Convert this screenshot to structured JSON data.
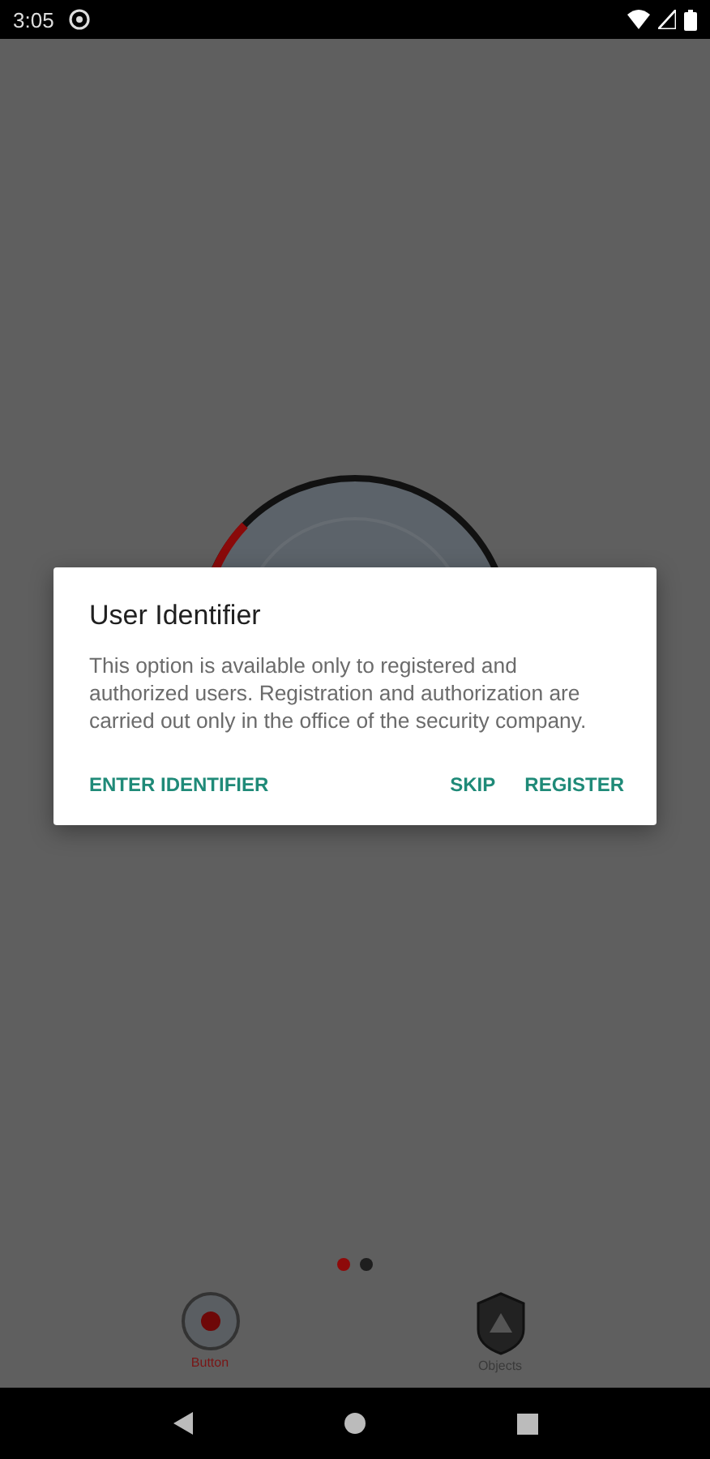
{
  "status_bar": {
    "time": "3:05"
  },
  "pages": [
    {
      "selected": true
    },
    {
      "selected": false
    }
  ],
  "bottom_nav": [
    {
      "label": "Button",
      "selected": true,
      "kind": "button"
    },
    {
      "label": "Objects",
      "selected": false,
      "kind": "shield"
    }
  ],
  "dialog": {
    "title": "User Identifier",
    "message": "This option is available only to registered and authorized users. Registration and authorization are carried out only in the office of the security company.",
    "actions": [
      "ENTER IDENTIFIER",
      "SKIP",
      "REGISTER"
    ]
  }
}
